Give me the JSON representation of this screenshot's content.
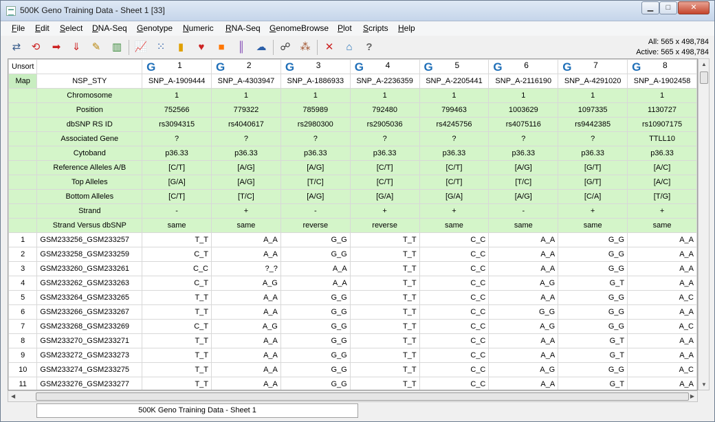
{
  "window": {
    "title": "500K Geno Training Data - Sheet 1 [33]"
  },
  "window_buttons": {
    "minimize": "▁",
    "maximize": "□",
    "close": "✕"
  },
  "menu": [
    "File",
    "Edit",
    "Select",
    "DNA-Seq",
    "Genotype",
    "Numeric",
    "RNA-Seq",
    "GenomeBrowse",
    "Plot",
    "Scripts",
    "Help"
  ],
  "toolbar": {
    "icons": [
      "transpose-icon",
      "flip-icon",
      "move-columns-icon",
      "sort-icon",
      "edit-icon",
      "columns-icon",
      "line-plot-icon",
      "scatter-plot-icon",
      "histogram-icon",
      "heatmap-icon",
      "gradient-icon",
      "bar-code-icon",
      "cloud-icon",
      "network-icon",
      "distribution-icon",
      "delete-icon",
      "home-icon",
      "help-icon"
    ],
    "counts_all": "All: 565 x 498,784",
    "counts_active": "Active: 565 x 498,784"
  },
  "grid": {
    "corner": "Unsort",
    "column_numbers": [
      "1",
      "2",
      "3",
      "4",
      "5",
      "6",
      "7",
      "8"
    ],
    "genotype_mark": "G",
    "map_label": "Map",
    "map_column_header": "NSP_STY",
    "snp_ids": [
      "SNP_A-1909444",
      "SNP_A-4303947",
      "SNP_A-1886933",
      "SNP_A-2236359",
      "SNP_A-2205441",
      "SNP_A-2116190",
      "SNP_A-4291020",
      "SNP_A-1902458"
    ],
    "meta_rows": [
      {
        "label": "Chromosome",
        "values": [
          "1",
          "1",
          "1",
          "1",
          "1",
          "1",
          "1",
          "1"
        ]
      },
      {
        "label": "Position",
        "values": [
          "752566",
          "779322",
          "785989",
          "792480",
          "799463",
          "1003629",
          "1097335",
          "1130727"
        ]
      },
      {
        "label": "dbSNP RS ID",
        "values": [
          "rs3094315",
          "rs4040617",
          "rs2980300",
          "rs2905036",
          "rs4245756",
          "rs4075116",
          "rs9442385",
          "rs10907175"
        ]
      },
      {
        "label": "Associated Gene",
        "values": [
          "?",
          "?",
          "?",
          "?",
          "?",
          "?",
          "?",
          "TTLL10"
        ]
      },
      {
        "label": "Cytoband",
        "values": [
          "p36.33",
          "p36.33",
          "p36.33",
          "p36.33",
          "p36.33",
          "p36.33",
          "p36.33",
          "p36.33"
        ]
      },
      {
        "label": "Reference Alleles A/B",
        "values": [
          "[C/T]",
          "[A/G]",
          "[A/G]",
          "[C/T]",
          "[C/T]",
          "[A/G]",
          "[G/T]",
          "[A/C]"
        ]
      },
      {
        "label": "Top Alleles",
        "values": [
          "[G/A]",
          "[A/G]",
          "[T/C]",
          "[C/T]",
          "[C/T]",
          "[T/C]",
          "[G/T]",
          "[A/C]"
        ]
      },
      {
        "label": "Bottom Alleles",
        "values": [
          "[C/T]",
          "[T/C]",
          "[A/G]",
          "[G/A]",
          "[G/A]",
          "[A/G]",
          "[C/A]",
          "[T/G]"
        ]
      },
      {
        "label": "Strand",
        "values": [
          "-",
          "+",
          "-",
          "+",
          "+",
          "-",
          "+",
          "+"
        ]
      },
      {
        "label": "Strand Versus dbSNP",
        "values": [
          "same",
          "same",
          "reverse",
          "reverse",
          "same",
          "same",
          "same",
          "same"
        ]
      }
    ],
    "data_rows": [
      {
        "num": "1",
        "id": "GSM233256_GSM233257",
        "values": [
          "T_T",
          "A_A",
          "G_G",
          "T_T",
          "C_C",
          "A_A",
          "G_G",
          "A_A"
        ]
      },
      {
        "num": "2",
        "id": "GSM233258_GSM233259",
        "values": [
          "C_T",
          "A_A",
          "G_G",
          "T_T",
          "C_C",
          "A_A",
          "G_G",
          "A_A"
        ]
      },
      {
        "num": "3",
        "id": "GSM233260_GSM233261",
        "values": [
          "C_C",
          "?_?",
          "A_A",
          "T_T",
          "C_C",
          "A_A",
          "G_G",
          "A_A"
        ]
      },
      {
        "num": "4",
        "id": "GSM233262_GSM233263",
        "values": [
          "C_T",
          "A_G",
          "A_A",
          "T_T",
          "C_C",
          "A_G",
          "G_T",
          "A_A"
        ]
      },
      {
        "num": "5",
        "id": "GSM233264_GSM233265",
        "values": [
          "T_T",
          "A_A",
          "G_G",
          "T_T",
          "C_C",
          "A_A",
          "G_G",
          "A_C"
        ]
      },
      {
        "num": "6",
        "id": "GSM233266_GSM233267",
        "values": [
          "T_T",
          "A_A",
          "G_G",
          "T_T",
          "C_C",
          "G_G",
          "G_G",
          "A_A"
        ]
      },
      {
        "num": "7",
        "id": "GSM233268_GSM233269",
        "values": [
          "C_T",
          "A_G",
          "G_G",
          "T_T",
          "C_C",
          "A_G",
          "G_G",
          "A_C"
        ]
      },
      {
        "num": "8",
        "id": "GSM233270_GSM233271",
        "values": [
          "T_T",
          "A_A",
          "G_G",
          "T_T",
          "C_C",
          "A_A",
          "G_T",
          "A_A"
        ]
      },
      {
        "num": "9",
        "id": "GSM233272_GSM233273",
        "values": [
          "T_T",
          "A_A",
          "G_G",
          "T_T",
          "C_C",
          "A_A",
          "G_T",
          "A_A"
        ]
      },
      {
        "num": "10",
        "id": "GSM233274_GSM233275",
        "values": [
          "T_T",
          "A_A",
          "G_G",
          "T_T",
          "C_C",
          "A_G",
          "G_G",
          "A_C"
        ]
      },
      {
        "num": "11",
        "id": "GSM233276_GSM233277",
        "values": [
          "T_T",
          "A_A",
          "G_G",
          "T_T",
          "C_C",
          "A_A",
          "G_T",
          "A_A"
        ]
      }
    ]
  },
  "tabs": {
    "sheet": "500K Geno Training Data - Sheet 1"
  }
}
